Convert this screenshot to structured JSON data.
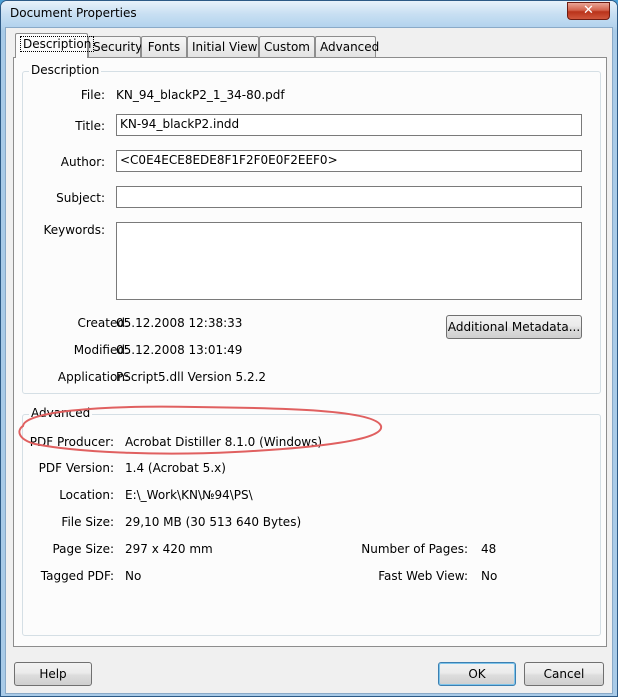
{
  "window": {
    "title": "Document Properties",
    "close_glyph": "✕"
  },
  "tabs": [
    {
      "label": "Description",
      "active": true
    },
    {
      "label": "Security",
      "active": false
    },
    {
      "label": "Fonts",
      "active": false
    },
    {
      "label": "Initial View",
      "active": false
    },
    {
      "label": "Custom",
      "active": false
    },
    {
      "label": "Advanced",
      "active": false
    }
  ],
  "description": {
    "group_label": "Description",
    "file_label": "File:",
    "file_value": "KN_94_blackP2_1_34-80.pdf",
    "title_label": "Title:",
    "title_value": "KN-94_blackP2.indd",
    "author_label": "Author:",
    "author_value": "<C0E4ECE8EDE8F1F2F0E0F2EEF0>",
    "subject_label": "Subject:",
    "subject_value": "",
    "keywords_label": "Keywords:",
    "keywords_value": "",
    "created_label": "Created:",
    "created_value": "05.12.2008 12:38:33",
    "modified_label": "Modified:",
    "modified_value": "05.12.2008 13:01:49",
    "application_label": "Application:",
    "application_value": "PScript5.dll Version 5.2.2",
    "metadata_button": "Additional Metadata..."
  },
  "advanced": {
    "group_label": "Advanced",
    "producer_label": "PDF Producer:",
    "producer_value": "Acrobat Distiller 8.1.0 (Windows)",
    "version_label": "PDF Version:",
    "version_value": "1.4 (Acrobat 5.x)",
    "location_label": "Location:",
    "location_value": "E:\\_Work\\KN\\№94\\PS\\",
    "filesize_label": "File Size:",
    "filesize_value": "29,10 MB (30 513 640 Bytes)",
    "pagesize_label": "Page Size:",
    "pagesize_value": "297 x 420 mm",
    "numpages_label": "Number of Pages:",
    "numpages_value": "48",
    "tagged_label": "Tagged PDF:",
    "tagged_value": "No",
    "fastweb_label": "Fast Web View:",
    "fastweb_value": "No"
  },
  "footer": {
    "help_button": "Help",
    "ok_button": "OK",
    "cancel_button": "Cancel"
  },
  "colors": {
    "annotation_circle": "#e06060"
  }
}
